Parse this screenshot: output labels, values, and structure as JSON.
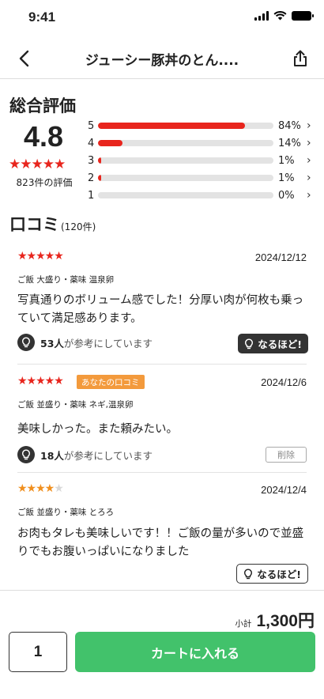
{
  "status_bar": {
    "time": "9:41"
  },
  "header": {
    "title": "ジューシー豚丼のとん....",
    "back_icon": "chevron-left-icon",
    "share_icon": "share-icon"
  },
  "overall": {
    "title": "総合評価",
    "score": "4.8",
    "stars": "★★★★★",
    "count_label": "823件の評価",
    "distribution": [
      {
        "label": "5",
        "percent": 84,
        "percent_label": "84%"
      },
      {
        "label": "4",
        "percent": 14,
        "percent_label": "14%"
      },
      {
        "label": "3",
        "percent": 1,
        "percent_label": "1%"
      },
      {
        "label": "2",
        "percent": 1,
        "percent_label": "1%"
      },
      {
        "label": "1",
        "percent": 0,
        "percent_label": "0%"
      }
    ]
  },
  "reviews_section": {
    "title": "口コミ",
    "count": "(120件)"
  },
  "reviews": [
    {
      "rating": 5,
      "stars": "★★★★★",
      "date": "2024/12/12",
      "tags": "ご飯 大盛り・薬味 温泉卵",
      "text": "写真通りのボリューム感でした！分厚い肉が何枚も乗っていて満足感あります。",
      "helpful_count": "53人",
      "helpful_suffix": "が参考にしています",
      "button_label": "なるほど!"
    },
    {
      "rating": 5,
      "stars": "★★★★★",
      "badge": "あなたの口コミ",
      "date": "2024/12/6",
      "tags": "ご飯 並盛り・薬味 ネギ,温泉卵",
      "text": "美味しかった。また頼みたい。",
      "helpful_count": "18人",
      "helpful_suffix": "が参考にしています",
      "button_label": "削除"
    },
    {
      "rating": 4,
      "stars_on": "★★★★",
      "stars_off": "★",
      "date": "2024/12/4",
      "tags": "ご飯 並盛り・薬味 とろろ",
      "text": "お肉もタレも美味しいです！！ご飯の量が多いので並盛りでもお腹いっぱいになりました",
      "button_label": "なるほど!"
    }
  ],
  "footer": {
    "subtotal_label": "小計",
    "subtotal_value": "1,300円",
    "quantity": "1",
    "cart_button": "カートに入れる"
  },
  "colors": {
    "accent_red": "#e8251d",
    "star_orange": "#f08f1e",
    "badge_orange": "#f39a3c",
    "cart_green": "#42c26b",
    "dark_button": "#333333"
  }
}
